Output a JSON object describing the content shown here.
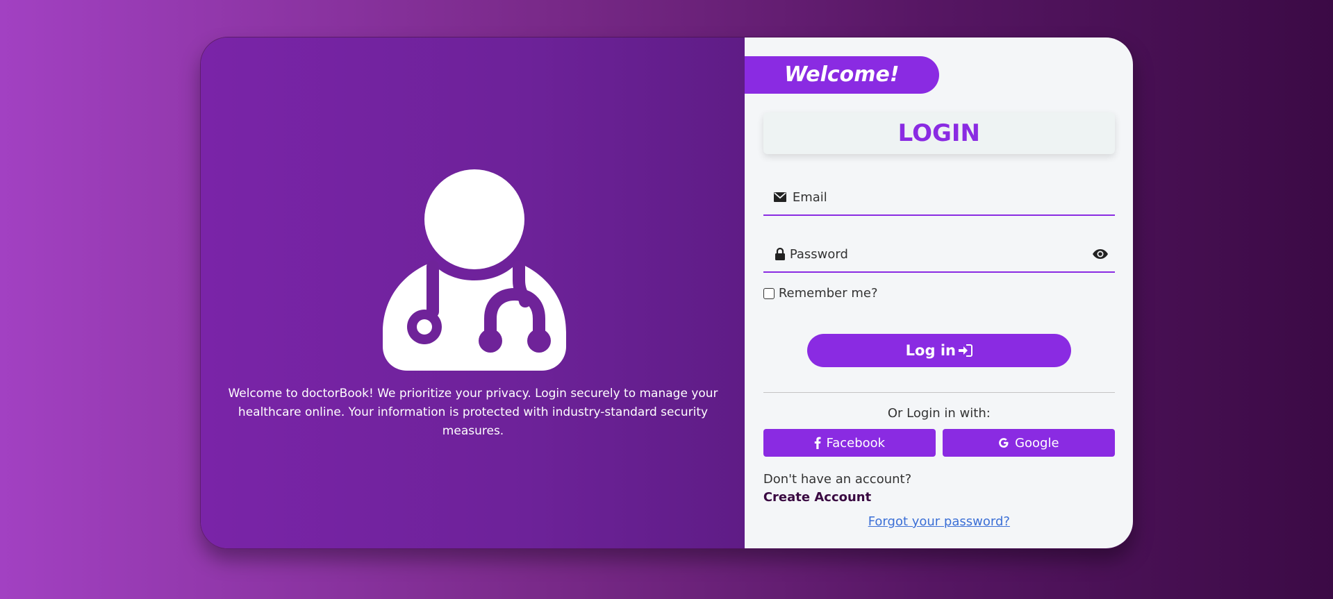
{
  "left_panel": {
    "icon": "doctor-icon",
    "description": "Welcome to doctorBook! We prioritize your privacy. Login securely to manage your healthcare online. Your information is protected with industry-standard security measures."
  },
  "right_panel": {
    "welcome_label": "Welcome!",
    "login_title": "LOGIN",
    "email": {
      "icon": "envelope-icon",
      "placeholder": "Email",
      "value": ""
    },
    "password": {
      "icon": "lock-icon",
      "placeholder": "Password",
      "value": "",
      "toggle_icon": "eye-icon"
    },
    "remember_label": "Remember me?",
    "login_button_label": "Log in",
    "login_button_icon": "sign-in-icon",
    "or_text": "Or Login in with:",
    "social": [
      {
        "label": "Facebook",
        "icon": "facebook-icon"
      },
      {
        "label": "Google",
        "icon": "google-icon"
      }
    ],
    "no_account_text": "Don't have an account?",
    "create_account_label": "Create Account",
    "forgot_password_label": "Forgot your password?"
  },
  "colors": {
    "accent": "#8a2be2",
    "left_panel_bg": "#7024a0",
    "right_panel_bg": "#f4f6f8",
    "link": "#3b6fd6",
    "create_account": "#3a0a42"
  }
}
